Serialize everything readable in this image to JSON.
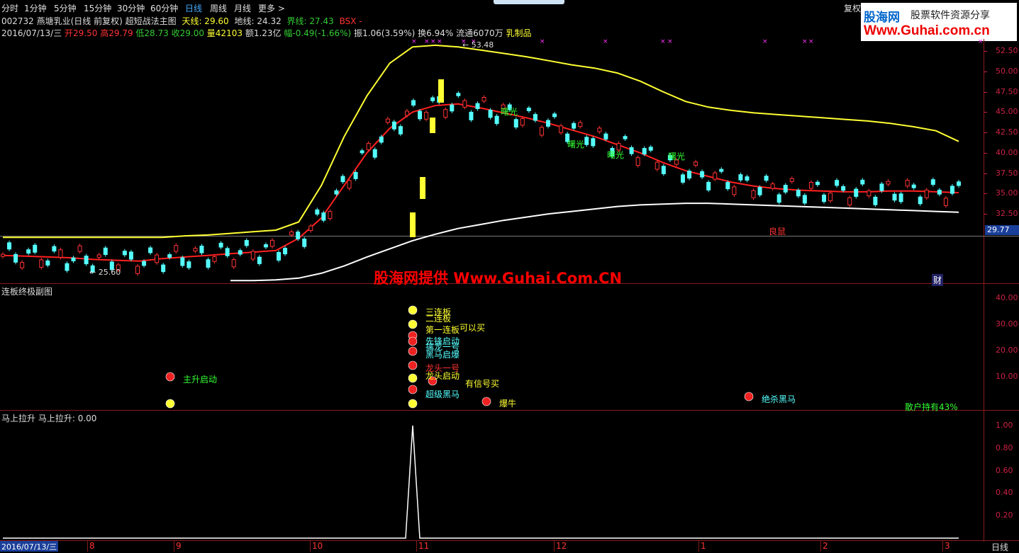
{
  "toolbar": {
    "periods": [
      "分时",
      "1分钟",
      "5分钟",
      "15分钟",
      "30分钟",
      "60分钟",
      "日线",
      "周线",
      "月线",
      "更多 >"
    ],
    "active": "日线",
    "right_label": "复权"
  },
  "watermark_logo": {
    "brand": "股海网",
    "slogan": "股票软件资源分享",
    "url": "Www.Guhai.com.cn"
  },
  "header": {
    "line1": {
      "stock": "002732 燕塘乳业(日线 前复权) 超短战法主图",
      "tian_label": "天线: 29.60",
      "di_label": "地线: 24.32",
      "jie_label": "界线: 27.43",
      "bsx_label": "BSX -"
    },
    "line2": {
      "date": "2016/07/13/三",
      "open": "开29.50",
      "high": "高29.79",
      "low": "低28.73",
      "close": "收29.00",
      "vol": "量42103",
      "amount": "额1.23亿",
      "change": "幅-0.49(-1.66%)",
      "amplitude": "振1.06(3.59%)",
      "turnover": "换6.94%",
      "float": "流通6070万",
      "sector": "乳制品"
    }
  },
  "main_panel": {
    "price_ticks": [
      "52.50",
      "50.00",
      "47.50",
      "45.00",
      "42.50",
      "40.00",
      "37.50",
      "35.00",
      "32.50"
    ],
    "current_price_tag": "29.77",
    "max_label": "53.48",
    "min_label": "25.60",
    "annotations": [
      "曙光",
      "曙光",
      "曙光",
      "曙光",
      "良鼠"
    ],
    "watermark": "股海网提供 Www.Guhai.Com.CN",
    "caifu_label": "财"
  },
  "sub_panel": {
    "title": "连板终极副图",
    "ticks": [
      "40.00",
      "30.00",
      "20.00",
      "10.00"
    ],
    "signals": [
      "三连板",
      "二连板",
      "第一连板",
      "可以买",
      "先锋启动",
      "擒龙一号",
      "黑马启爆",
      "龙头一号",
      "龙头启动",
      "有信号买",
      "超级黑马",
      "主升启动",
      "爆牛",
      "绝杀黑马"
    ],
    "retail_holding": "散户持有43%"
  },
  "bottom_panel": {
    "title": "马上拉升",
    "value_label": "马上拉升: 0.00",
    "ticks": [
      "1.00",
      "0.80",
      "0.60",
      "0.40",
      "0.20"
    ]
  },
  "x_axis": {
    "date_box": "2016/07/13/三",
    "month_labels": [
      "8",
      "9",
      "10",
      "11",
      "12",
      "1",
      "2",
      "3"
    ],
    "period_label": "日线"
  },
  "chart_data": {
    "type": "line",
    "title": "002732 燕塘乳业(日线 前复权) 超短战法主图",
    "ylim": [
      22,
      55
    ],
    "series": [
      {
        "name": "天线",
        "color": "#ffff33",
        "values": [
          29.6,
          29.6,
          29.6,
          29.6,
          29.6,
          29.6,
          29.6,
          29.6,
          29.8,
          29.9,
          30.1,
          30.3,
          30.5,
          31.5,
          36,
          42,
          47,
          51,
          53,
          53.2,
          53,
          52.6,
          52.2,
          51.8,
          51.3,
          50.8,
          50.4,
          49.8,
          48.8,
          47.5,
          46.3,
          45.6,
          45.2,
          44.9,
          44.7,
          44.5,
          44.3,
          44.1,
          43.9,
          43.6,
          43.2,
          42.7,
          41.4
        ]
      },
      {
        "name": "界线",
        "color": "#ff2020",
        "values": [
          27.4,
          27.3,
          27.2,
          27.1,
          26.9,
          26.8,
          26.7,
          27.0,
          27.2,
          27.4,
          27.6,
          27.8,
          28.0,
          29.5,
          32,
          36,
          40,
          43,
          45,
          45.8,
          46,
          45.5,
          44.9,
          44.3,
          43.6,
          42.8,
          42,
          41,
          40,
          38.8,
          37.8,
          37.1,
          36.4,
          35.9,
          35.6,
          35.4,
          35.3,
          35.2,
          35.2,
          35.3,
          35.3,
          35.2,
          35.1
        ]
      },
      {
        "name": "地线",
        "color": "#ffffff",
        "values": [
          null,
          null,
          null,
          null,
          null,
          null,
          null,
          null,
          null,
          null,
          24.3,
          24.3,
          24.4,
          24.6,
          25.2,
          26.1,
          27.2,
          28.2,
          29.2,
          30.0,
          30.7,
          31.2,
          31.7,
          32.1,
          32.5,
          32.8,
          33.1,
          33.4,
          33.6,
          33.7,
          33.8,
          33.8,
          33.7,
          33.6,
          33.5,
          33.4,
          33.3,
          33.2,
          33.1,
          33.0,
          32.9,
          32.8,
          32.7
        ]
      }
    ],
    "sub_chart": {
      "name": "马上拉升",
      "ylim": [
        0,
        1.0
      ],
      "peak_value": 1.0
    }
  }
}
